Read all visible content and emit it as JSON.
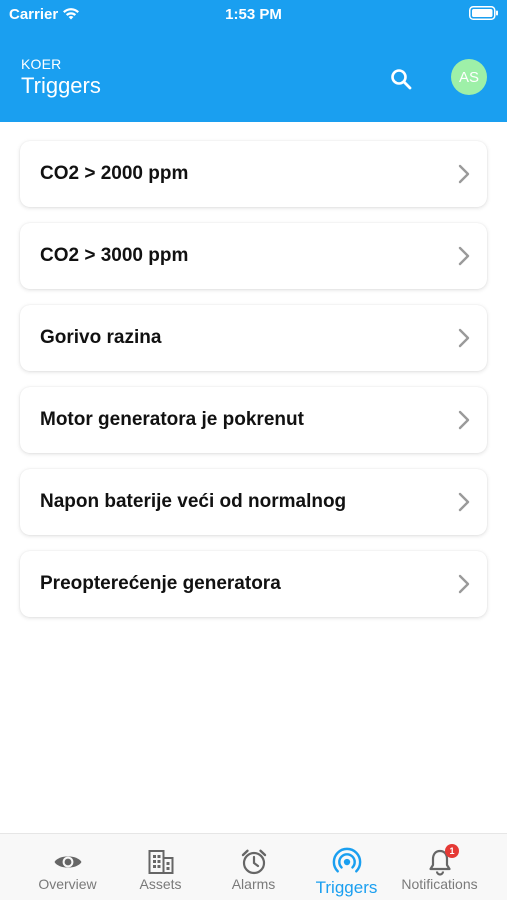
{
  "status_bar": {
    "carrier": "Carrier",
    "time": "1:53 PM"
  },
  "header": {
    "org": "KOER",
    "title": "Triggers",
    "avatar_initials": "AS",
    "background_color": "#1a9ff0",
    "avatar_color": "#9ef0a8",
    "search_icon": "search-icon"
  },
  "triggers": [
    {
      "label": "CO2 > 2000 ppm"
    },
    {
      "label": "CO2 > 3000 ppm"
    },
    {
      "label": "Gorivo razina"
    },
    {
      "label": "Motor generatora je pokrenut"
    },
    {
      "label": "Napon baterije veći od normalnog"
    },
    {
      "label": "Preopterećenje generatora"
    }
  ],
  "tabbar": {
    "active_color": "#1a9ff0",
    "inactive_color": "#7a7a7a",
    "tabs": [
      {
        "label": "Overview",
        "icon": "eye-icon",
        "active": false
      },
      {
        "label": "Assets",
        "icon": "building-icon",
        "active": false
      },
      {
        "label": "Alarms",
        "icon": "alarm-clock-icon",
        "active": false
      },
      {
        "label": "Triggers",
        "icon": "broadcast-icon",
        "active": true
      },
      {
        "label": "Notifications",
        "icon": "bell-icon",
        "active": false,
        "badge": "1"
      }
    ]
  }
}
